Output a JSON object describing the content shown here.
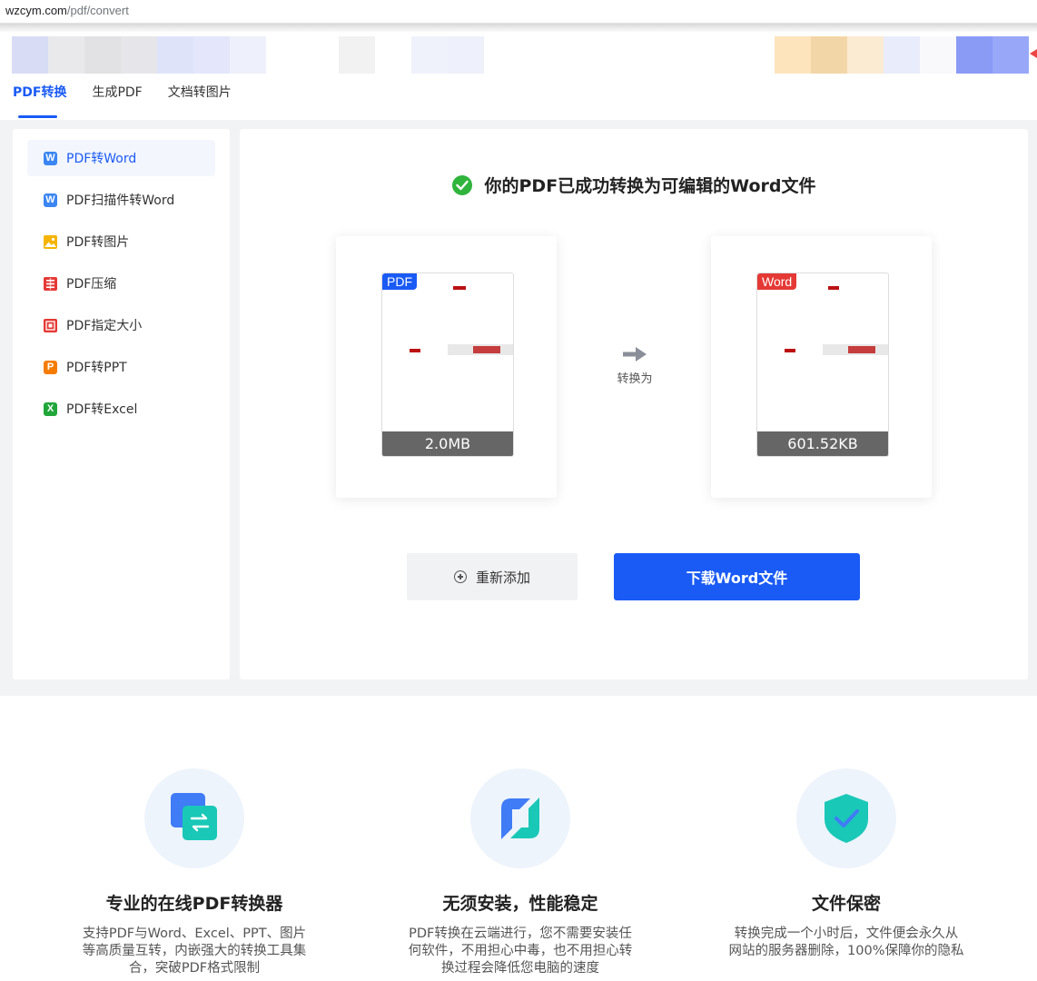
{
  "browser": {
    "url_domain": "wzcym.com",
    "url_path": "/pdf/convert"
  },
  "tabs": [
    {
      "label": "PDF转换",
      "active": true
    },
    {
      "label": "生成PDF",
      "active": false
    },
    {
      "label": "文档转图片",
      "active": false
    }
  ],
  "sidebar": {
    "items": [
      {
        "label": "PDF转Word",
        "icon": "word-icon",
        "icon_letter": "W",
        "color": "#3b86f2",
        "active": true
      },
      {
        "label": "PDF扫描件转Word",
        "icon": "word-icon",
        "icon_letter": "W",
        "color": "#3b86f2",
        "active": false
      },
      {
        "label": "PDF转图片",
        "icon": "image-icon",
        "icon_letter": "",
        "color": "#f5b400",
        "active": false
      },
      {
        "label": "PDF压缩",
        "icon": "compress-icon",
        "icon_letter": "",
        "color": "#e53935",
        "active": false
      },
      {
        "label": "PDF指定大小",
        "icon": "resize-icon",
        "icon_letter": "",
        "color": "#e53935",
        "active": false
      },
      {
        "label": "PDF转PPT",
        "icon": "ppt-icon",
        "icon_letter": "P",
        "color": "#f57c00",
        "active": false
      },
      {
        "label": "PDF转Excel",
        "icon": "excel-icon",
        "icon_letter": "X",
        "color": "#21a63a",
        "active": false
      }
    ]
  },
  "result": {
    "success_message": "你的PDF已成功转换为可编辑的Word文件",
    "source": {
      "badge": "PDF",
      "badge_color": "#1a5bf5",
      "size": "2.0MB"
    },
    "target": {
      "badge": "Word",
      "badge_color": "#e53935",
      "size": "601.52KB"
    },
    "convert_label": "转换为"
  },
  "actions": {
    "readd_label": "重新添加",
    "download_label": "下载Word文件"
  },
  "features": [
    {
      "title": "专业的在线PDF转换器",
      "desc": "支持PDF与Word、Excel、PPT、图片等高质量互转，内嵌强大的转换工具集合，突破PDF格式限制",
      "icon": "convert-icon"
    },
    {
      "title": "无须安装，性能稳定",
      "desc": "PDF转换在云端进行，您不需要安装任何软件，不用担心中毒，也不用担心转换过程会降低您电脑的速度",
      "icon": "cloud-icon"
    },
    {
      "title": "文件保密",
      "desc": "转换完成一个小时后，文件便会永久从网站的服务器删除，100%保障你的隐私",
      "icon": "shield-check-icon"
    }
  ]
}
